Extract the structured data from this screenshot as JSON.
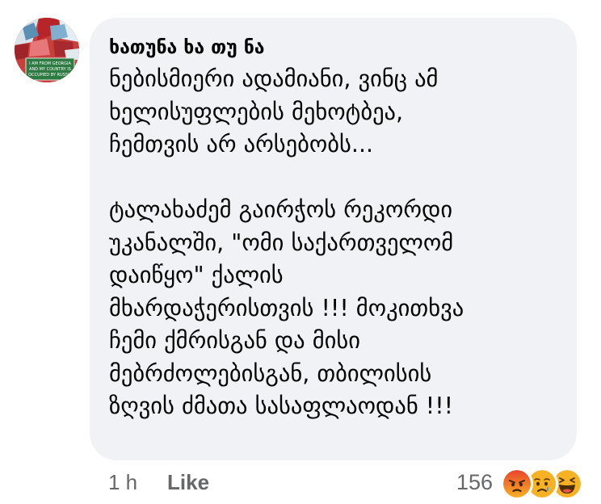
{
  "comment": {
    "author": "ხათუნა ხა თუ ნა",
    "text": "ნებისმიერი ადამიანი, ვინც ამ\nხელისუფლების მეხოტბეა,\nჩემთვის არ არსებობს...\n\nტალახაძემ გაირჭოს რეკორდი\nუკანალში, \"ომი საქართველომ\nდაიწყო\" ქალის\nმხარდაჭერისთვის !!! მოკითხვა\nჩემი ქმრისგან და მისი\nმებრძოლებისგან, თბილისის\nზღვის ძმათა სასაფლაოდან !!!",
    "avatar_sign_text": [
      "I AM FROM GEORGIA",
      "AND MY COUNTRY IS",
      "OCCUPIED BY RUSSIA"
    ]
  },
  "footer": {
    "timestamp": "1 h",
    "like_label": "Like",
    "reaction_count": "156"
  },
  "reactions": [
    {
      "icon": "angry-reaction-icon",
      "color": "#f0522a"
    },
    {
      "icon": "sad-reaction-icon",
      "color": "#f7b125"
    },
    {
      "icon": "haha-reaction-icon",
      "color": "#f7b125"
    }
  ],
  "colors": {
    "bubble_background": "#f0f2f5",
    "text": "#050505",
    "secondary_text": "#65676b"
  }
}
